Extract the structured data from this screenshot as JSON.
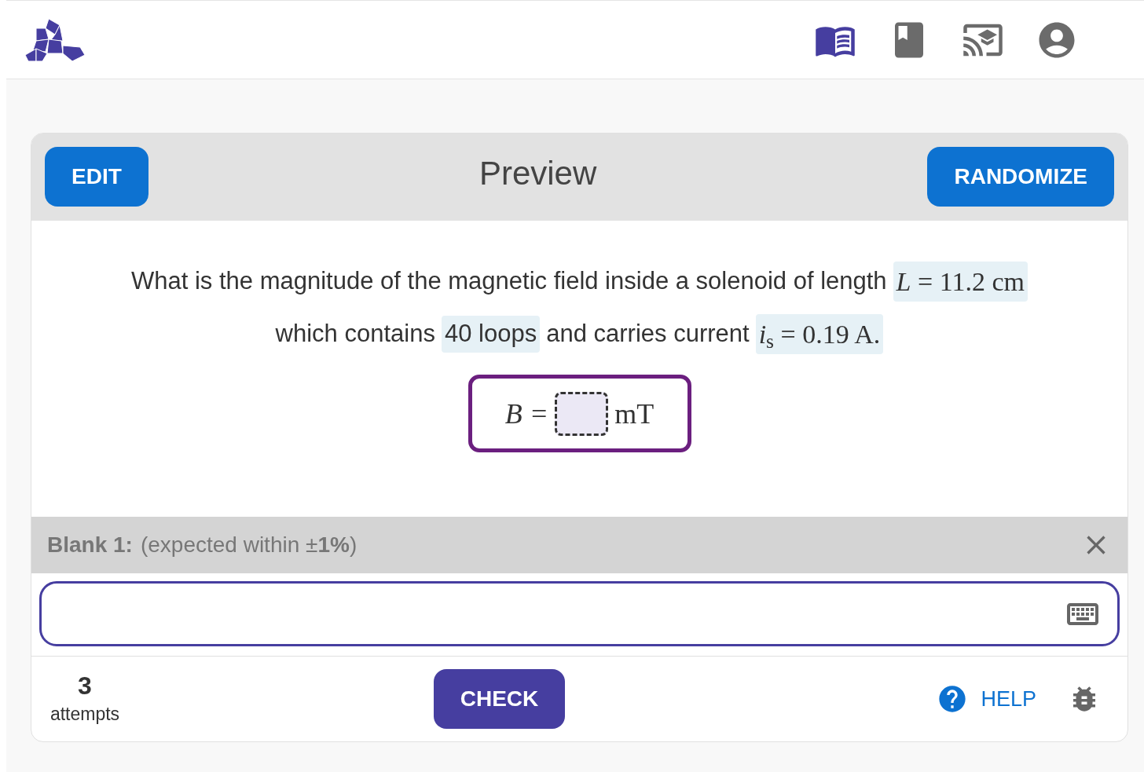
{
  "header": {
    "nav_icons": [
      {
        "kind": "reader",
        "selected": true
      },
      {
        "kind": "book",
        "selected": false
      },
      {
        "kind": "cast",
        "selected": false
      },
      {
        "kind": "account",
        "selected": false
      }
    ]
  },
  "preview": {
    "edit_button": "EDIT",
    "title": "Preview",
    "randomize_button": "RANDOMIZE",
    "question_lines": [
      [
        {
          "kind": "text",
          "text": "What is the magnitude of the magnetic field inside a solenoid of length",
          "highlighted": false
        },
        {
          "kind": "math",
          "text": "*L* = 11.2 cm",
          "highlighted": true
        }
      ],
      [
        {
          "kind": "text",
          "text": "which contains",
          "highlighted": false
        },
        {
          "kind": "text",
          "text": "40 loops",
          "highlighted": true
        },
        {
          "kind": "text",
          "text": "and carries current",
          "highlighted": false
        },
        {
          "kind": "math",
          "text": "*i*$_{s}$ = 0.19 A.",
          "highlighted": true
        }
      ]
    ],
    "answer": {
      "lhs": "B =",
      "unit": "mT"
    },
    "blank": {
      "label": "Blank 1:",
      "hint": "(expected within ±**1%**)"
    },
    "footer": {
      "attempts_count": "3",
      "attempts_label": "attempts",
      "check_button": "CHECK",
      "help_link": "HELP"
    }
  }
}
